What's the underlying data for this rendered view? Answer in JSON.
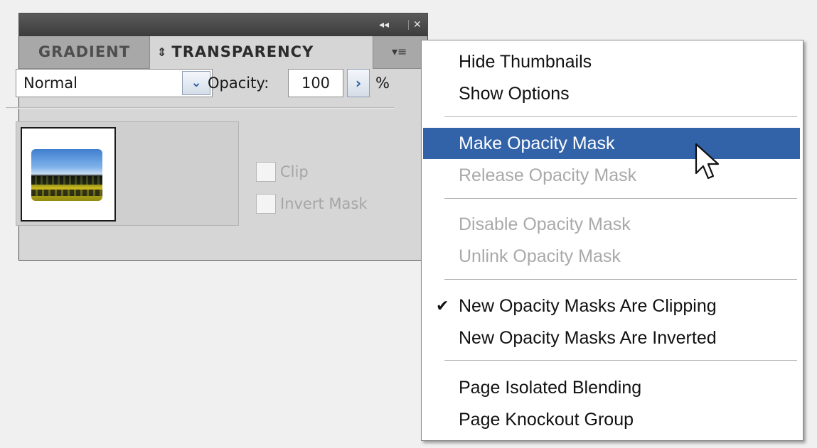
{
  "panel": {
    "titlebar": {
      "collapse_icon": "◂◂",
      "close_icon": "✕"
    },
    "tabs": [
      {
        "label": "GRADIENT"
      },
      {
        "label": "TRANSPARENCY",
        "arrows": "⇕"
      }
    ],
    "menu_icon": "▾≡",
    "blend_mode": {
      "value": "Normal",
      "dropdown_icon": "⌄"
    },
    "opacity": {
      "label": "Opacity:",
      "value": "100",
      "stepper_icon": "›",
      "unit": "%"
    },
    "clip": {
      "label": "Clip"
    },
    "invert_mask": {
      "label": "Invert Mask"
    }
  },
  "menu": {
    "items": [
      {
        "label": "Hide Thumbnails",
        "state": "enabled"
      },
      {
        "label": "Show Options",
        "state": "enabled"
      },
      {
        "label": "Make Opacity Mask",
        "state": "highlighted"
      },
      {
        "label": "Release Opacity Mask",
        "state": "disabled"
      },
      {
        "label": "Disable Opacity Mask",
        "state": "disabled"
      },
      {
        "label": "Unlink Opacity Mask",
        "state": "disabled"
      },
      {
        "label": "New Opacity Masks Are Clipping",
        "state": "enabled",
        "checked": true,
        "check_icon": "✔"
      },
      {
        "label": "New Opacity Masks Are Inverted",
        "state": "enabled"
      },
      {
        "label": "Page Isolated Blending",
        "state": "enabled"
      },
      {
        "label": "Page Knockout Group",
        "state": "enabled"
      }
    ]
  },
  "colors": {
    "panel_bg": "#d6d6d6",
    "titlebar": "#3c3c3c",
    "menu_highlight": "#3263a8",
    "disabled_text": "#a9a9a9"
  }
}
